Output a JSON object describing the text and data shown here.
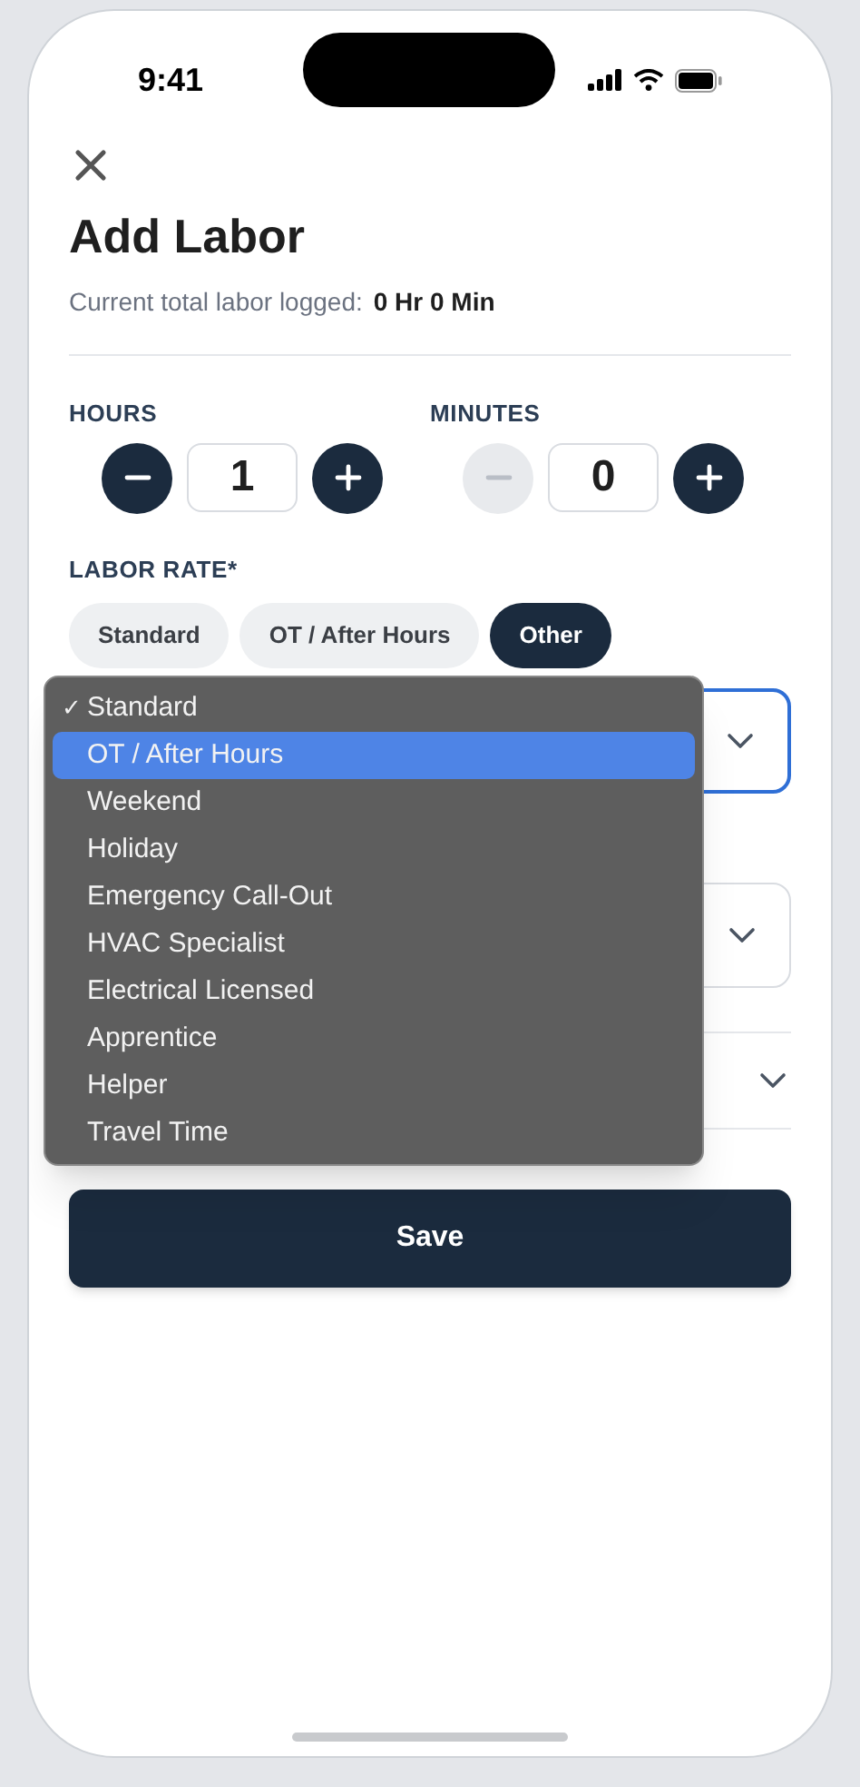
{
  "status_bar": {
    "time": "9:41"
  },
  "title": "Add Labor",
  "summary": {
    "label": "Current total labor logged:",
    "value": "0 Hr 0 Min"
  },
  "steppers": [
    {
      "label": "HOURS",
      "value": "1",
      "minus_disabled": false,
      "plus_disabled": false
    },
    {
      "label": "MINUTES",
      "value": "0",
      "minus_disabled": true,
      "plus_disabled": false
    }
  ],
  "labor_rate": {
    "label": "LABOR RATE*",
    "chips": [
      {
        "label": "Standard",
        "selected": false
      },
      {
        "label": "OT / After Hours",
        "selected": false
      },
      {
        "label": "Other",
        "selected": true
      }
    ]
  },
  "selects": [
    {
      "focused": true
    },
    {
      "focused": false
    }
  ],
  "collapsible_row": {
    "expanded": false
  },
  "dropdown_menu": {
    "check_mark": "✓",
    "items": [
      {
        "label": "Standard",
        "selected": true,
        "highlighted": false
      },
      {
        "label": "OT / After Hours",
        "selected": false,
        "highlighted": true
      },
      {
        "label": "Weekend",
        "selected": false,
        "highlighted": false
      },
      {
        "label": "Holiday",
        "selected": false,
        "highlighted": false
      },
      {
        "label": "Emergency Call-Out",
        "selected": false,
        "highlighted": false
      },
      {
        "label": "HVAC Specialist",
        "selected": false,
        "highlighted": false
      },
      {
        "label": "Electrical Licensed",
        "selected": false,
        "highlighted": false
      },
      {
        "label": "Apprentice",
        "selected": false,
        "highlighted": false
      },
      {
        "label": "Helper",
        "selected": false,
        "highlighted": false
      },
      {
        "label": "Travel Time",
        "selected": false,
        "highlighted": false
      }
    ]
  },
  "save_button": "Save"
}
